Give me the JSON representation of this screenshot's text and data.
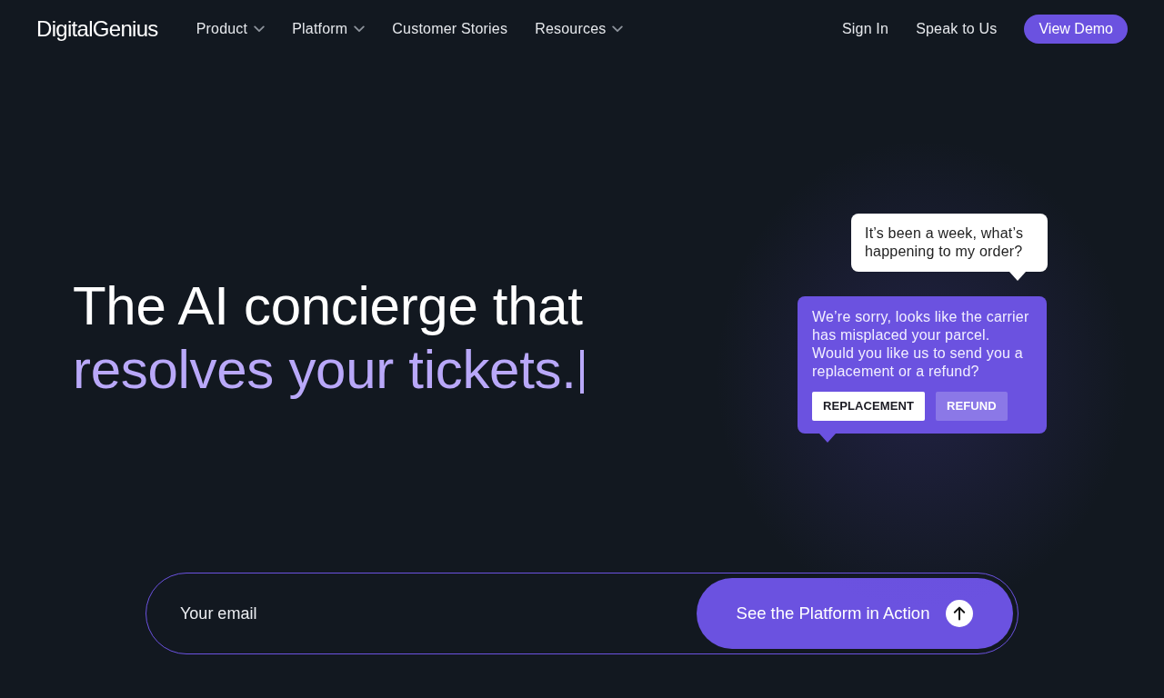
{
  "nav": {
    "logo": "DigitalGenius",
    "menu": [
      {
        "label": "Product",
        "dropdown": true
      },
      {
        "label": "Platform",
        "dropdown": true
      },
      {
        "label": "Customer Stories",
        "dropdown": false
      },
      {
        "label": "Resources",
        "dropdown": true
      }
    ],
    "actions": [
      {
        "label": "Sign In",
        "kind": "link"
      },
      {
        "label": "Speak to Us",
        "kind": "link"
      },
      {
        "label": "View Demo",
        "kind": "button"
      }
    ]
  },
  "hero": {
    "headline": [
      {
        "text": "The AI concierge that",
        "kind": "plain"
      },
      {
        "text": "resolves your tickets.",
        "kind": "accent"
      }
    ],
    "typing_cursor": true
  },
  "chat": [
    {
      "kind": "customer",
      "text": "It’s been a week, what’s happening to my order?"
    },
    {
      "kind": "agent",
      "text": "We’re sorry, looks like the carrier has misplaced your parcel. Would you like us to send you a replacement or a refund?",
      "replies": [
        {
          "label": "REPLACEMENT",
          "kind": "solid"
        },
        {
          "label": "REFUND",
          "kind": "faded"
        }
      ]
    }
  ],
  "signup": {
    "placeholder": "Your email",
    "button": "See the Platform in Action"
  }
}
